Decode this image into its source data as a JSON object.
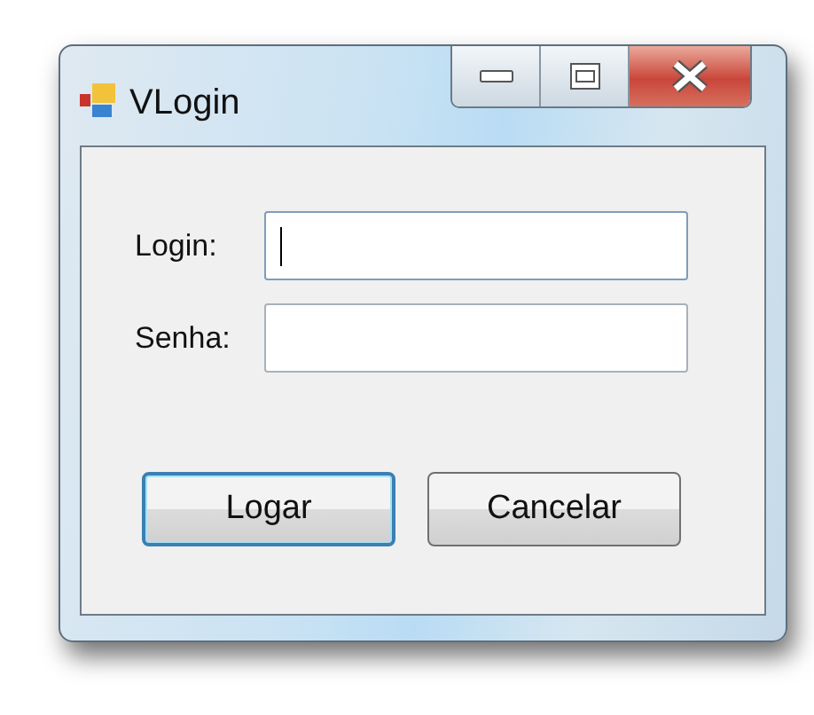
{
  "window": {
    "title": "VLogin"
  },
  "fields": [
    {
      "label": "Login:",
      "focused": true
    },
    {
      "label": "Senha:",
      "focused": false
    }
  ],
  "buttons": [
    {
      "label": "Logar",
      "default": true
    },
    {
      "label": "Cancelar",
      "default": false
    }
  ]
}
